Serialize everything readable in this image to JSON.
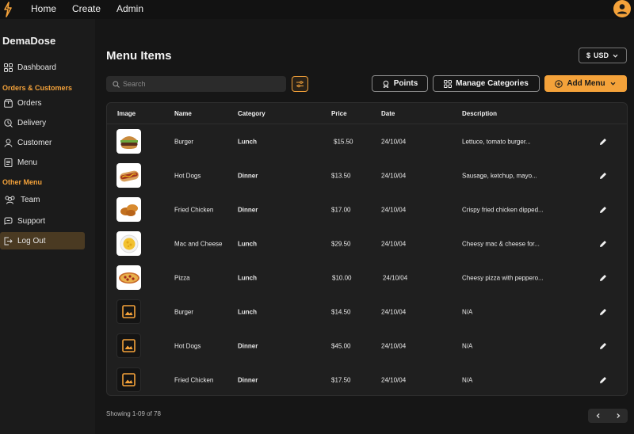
{
  "topbar": {
    "nav": [
      "Home",
      "Create",
      "Admin"
    ],
    "logo_icon": "lightning-icon",
    "avatar_icon": "user-icon",
    "accent": "#f4a23a"
  },
  "sidebar": {
    "brand": "DemaDose",
    "dashboard_label": "Dashboard",
    "section_orders": "Orders & Customers",
    "orders_label": "Orders",
    "delivery_label": "Delivery",
    "customer_label": "Customer",
    "menu_label": "Menu",
    "section_other": "Other Menu",
    "team_label": "Team",
    "support_label": "Support",
    "logout_label": "Log Out"
  },
  "main": {
    "title": "Menu Items",
    "currency": "USD",
    "search_placeholder": "Search",
    "points_label": "Points",
    "manage_label": "Manage Categories",
    "add_label": "Add Menu"
  },
  "table": {
    "headers": {
      "image": "Image",
      "name": "Name",
      "category": "Category",
      "price": "Price",
      "date": "Date",
      "description": "Description"
    },
    "rows": [
      {
        "image": "burger",
        "name": "Burger",
        "category": "Lunch",
        "price": "$15.50",
        "date": "24/10/04",
        "description": "Lettuce, tomato burger..."
      },
      {
        "image": "hotdog",
        "name": "Hot Dogs",
        "category": "Dinner",
        "price": "$13.50",
        "date": "24/10/04",
        "description": "Sausage, ketchup, mayo..."
      },
      {
        "image": "chicken",
        "name": "Fried Chicken",
        "category": "Dinner",
        "price": "$17.00",
        "date": "24/10/04",
        "description": "Crispy fried chicken dipped..."
      },
      {
        "image": "mac",
        "name": "Mac and Cheese",
        "category": "Lunch",
        "price": "$29.50",
        "date": "24/10/04",
        "description": "Cheesy mac & cheese for..."
      },
      {
        "image": "pizza",
        "name": "Pizza",
        "category": "Lunch",
        "price": "$10.00",
        "date": "24/10/04",
        "description": "Cheesy pizza with peppero..."
      },
      {
        "image": "placeholder",
        "name": "Burger",
        "category": "Lunch",
        "price": "$14.50",
        "date": "24/10/04",
        "description": "N/A"
      },
      {
        "image": "placeholder",
        "name": "Hot Dogs",
        "category": "Dinner",
        "price": "$45.00",
        "date": "24/10/04",
        "description": "N/A"
      },
      {
        "image": "placeholder",
        "name": "Fried Chicken",
        "category": "Dinner",
        "price": "$17.50",
        "date": "24/10/04",
        "description": "N/A"
      }
    ]
  },
  "footer": {
    "showing": "Showing 1-09 of 78"
  }
}
